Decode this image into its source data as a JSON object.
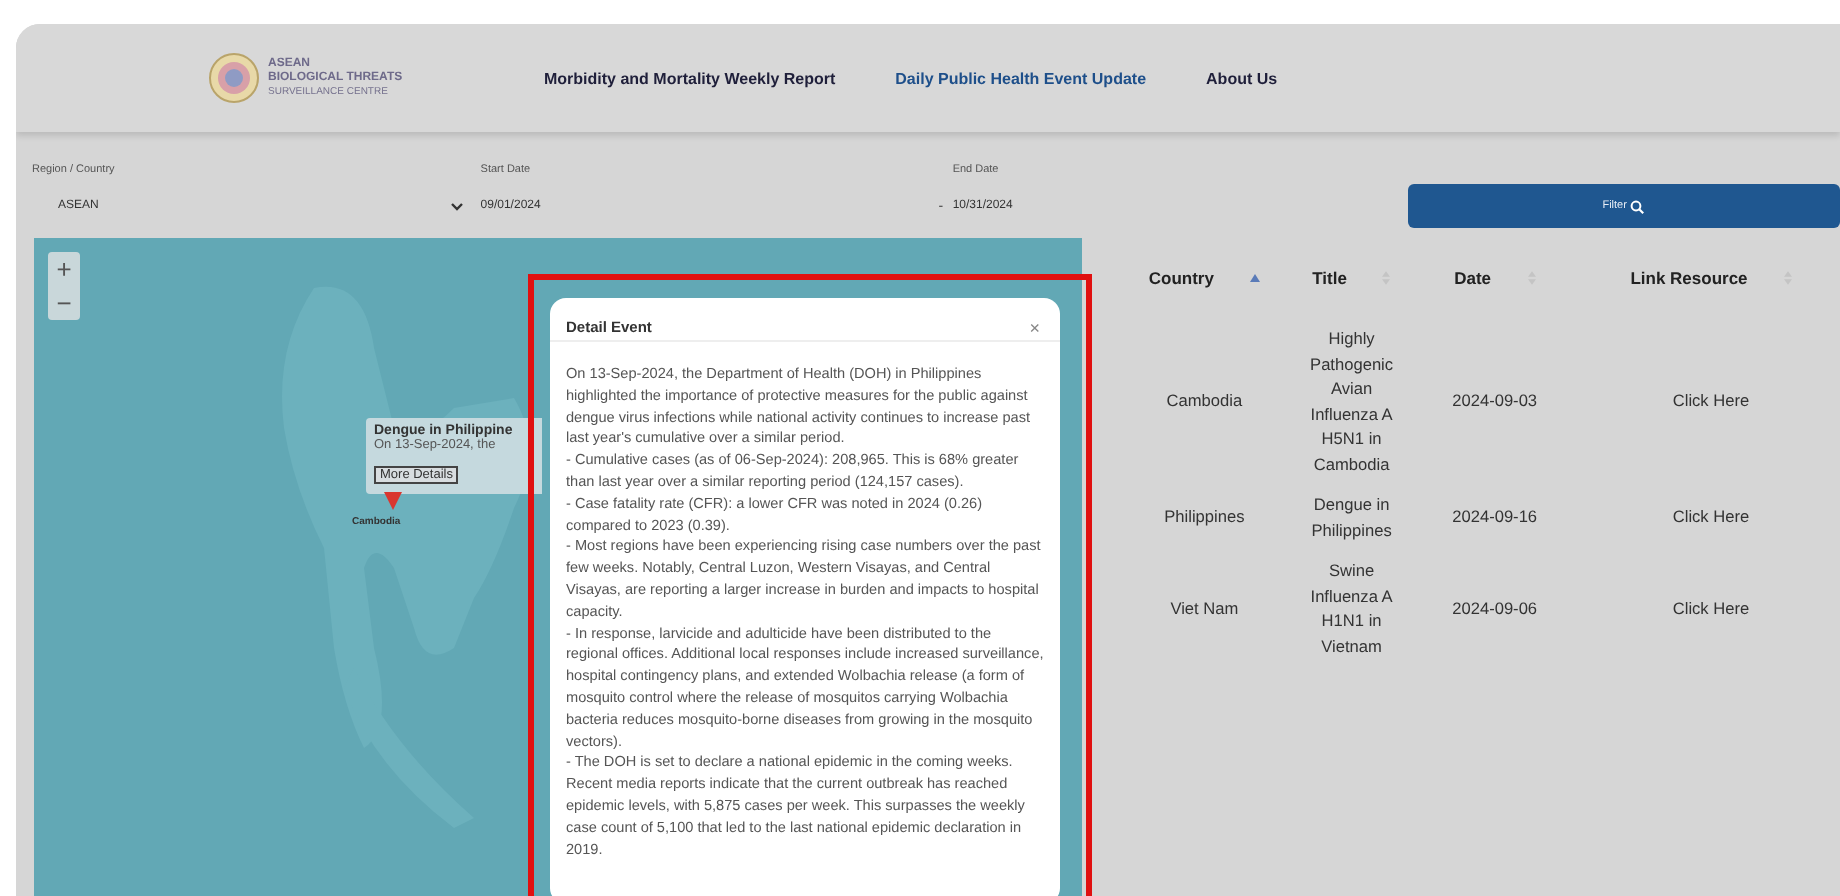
{
  "header": {
    "logo": {
      "lines": [
        "ASEAN",
        "BIOLOGICAL THREATS",
        "SURVEILLANCE CENTRE"
      ]
    },
    "nav": [
      {
        "label": "Morbidity and Mortality Weekly Report",
        "selected": false
      },
      {
        "label": "Daily Public Health Event Update",
        "selected": true
      },
      {
        "label": "About Us",
        "selected": false
      }
    ]
  },
  "filters": {
    "region": {
      "label": "Region / Country",
      "value": "ASEAN"
    },
    "start_date": {
      "label": "Start Date",
      "value": "09/01/2024"
    },
    "separator": "-",
    "end_date": {
      "label": "End Date",
      "value": "10/31/2024"
    },
    "button": "Filter"
  },
  "map": {
    "zoom_in": "+",
    "zoom_out": "−",
    "popup": {
      "title": "Dengue in Philippine",
      "text": "On 13-Sep-2024, the",
      "button": "More Details"
    },
    "marker_label": "Cambodia"
  },
  "table": {
    "columns": [
      {
        "label": "Country",
        "sorted": true
      },
      {
        "label": "Title",
        "sorted": false
      },
      {
        "label": "Date",
        "sorted": false
      },
      {
        "label": "Link Resource",
        "sorted": false
      }
    ],
    "rows": [
      {
        "country": "Cambodia",
        "title": "Highly Pathogenic Avian Influenza A H5N1 in Cambodia",
        "date": "2024-09-03",
        "link": "Click Here"
      },
      {
        "country": "Philippines",
        "title": "Dengue in Philippines",
        "date": "2024-09-16",
        "link": "Click Here"
      },
      {
        "country": "Viet Nam",
        "title": "Swine Influenza A H1N1 in Vietnam",
        "date": "2024-09-06",
        "link": "Click Here"
      }
    ]
  },
  "modal": {
    "title": "Detail Event",
    "close": "×",
    "highlighted": true,
    "body": "On 13-Sep-2024, the Department of Health (DOH) in Philippines highlighted the importance of protective measures for the public against dengue virus infections while national activity continues to increase past last year's cumulative over a similar period.\n- Cumulative cases (as of 06-Sep-2024): 208,965. This is 68% greater than last year over a similar reporting period (124,157 cases).\n- Case fatality rate (CFR): a lower CFR was noted in 2024 (0.26) compared to 2023 (0.39).\n- Most regions have been experiencing rising case numbers over the past few weeks. Notably, Central Luzon, Western Visayas, and Central Visayas, are reporting a larger increase in burden and impacts to hospital capacity.\n- In response, larvicide and adulticide have been distributed to the regional offices. Additional local responses include increased surveillance, hospital contingency plans, and extended Wolbachia release (a form of mosquito control where the release of mosquitos carrying Wolbachia bacteria reduces mosquito-borne diseases from growing in the mosquito vectors).\n- The DOH is set to declare a national epidemic in the coming weeks. Recent media reports indicate that the current outbreak has reached epidemic levels, with 5,875 cases per week. This surpasses the weekly case count of 5,100 that led to the last national epidemic declaration in 2019."
  }
}
